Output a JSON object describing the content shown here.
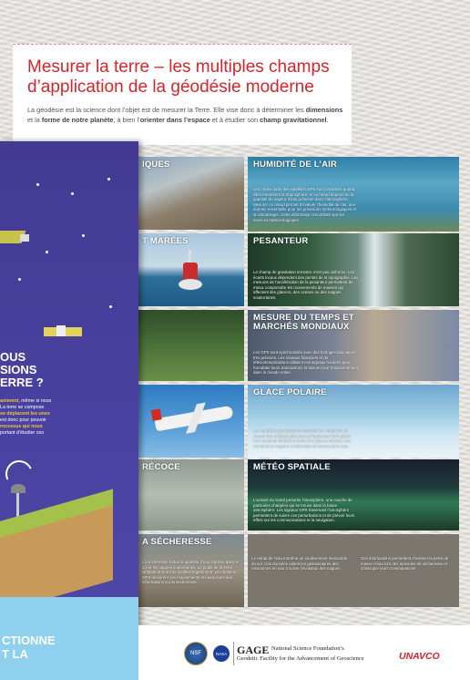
{
  "header": {
    "title": "Mesurer la terre – les multiples champs d’application de la géodésie moderne",
    "intro_parts": [
      "La géodésie est la science dont l’objet est de mesurer la Terre. Elle vise donc à déterminer les ",
      "dimensions",
      " et la ",
      "forme de notre planète",
      ", à bien l’",
      "orienter dans l’espace",
      " et à étudier son ",
      "champ gravitationnel",
      "."
    ]
  },
  "cards": {
    "left_labels": [
      "IQUES",
      "T MARÉES",
      "RÉCOCE",
      "A SÉCHERESSE"
    ],
    "humidity": {
      "title": "HUMIDITÉ DE L’AIR",
      "text": "Les ondes radio des satellites GPS sont retardées quand elles traversent la troposphère, et ce retard dépend de la quantité de vapeur d’eau présente dans l’atmosphère. Mesurer ce retard permet d’évaluer l’humidité de l’air, une donnée essentielle pour les prévisions météorologiques et la climatologie. Cette information est utilisée par les services météorologiques."
    },
    "gravity": {
      "title": "PESANTEUR",
      "text": "Le champ de gravitation terrestre n’est pas uniforme. Les écarts locaux dépendent des pentes de la topographie. Les mesures de l’accélération de la pesanteur permettent de mieux comprendre les mouvements de masses qui affectent des glaciers, des océans ou des nappes souterraines."
    },
    "time": {
      "title": "MESURE DU TEMPS ET MARCHÉS MONDIAUX",
      "text": "Les GPS sont synchronisés avec des horloges atomiques très précises. Les réseaux financiers et de télécommunications utilisent ces signaux horaires pour horodater leurs transactions et assurer leur fonctionnement dans le monde entier."
    },
    "ice": {
      "title": "GLACE POLAIRE",
      "text": "Les satellites géodésiques mesurent les variations de masse des calottes glaciaires et l’épaisseur de la glace. Ces mesures révèlent la fonte des glaces polaires, une contribution majeure à l’élévation du niveau de la mer."
    },
    "space": {
      "title": "MÉTÉO SPATIALE",
      "text": "L’activité du Soleil perturbe l’ionosphère, une couche de particules chargées qui se trouve dans la haute atmosphère. Les signaux GPS traversant l’ionosphère permettent de suivre ces perturbations et de prévoir leurs effets sur les communications et la navigation."
    },
    "bottom_texts": [
      "La sécheresse réduit la quantité d’eau stockée dans le sol et les nappes souterraines. Le poids de la Terre diminue et le sol se soulève légèrement. Les stations GPS mesurent ces mouvements et fournissent des informations sur la sécheresse.",
      "Le retrait de l’eau entraîne un soulèvement mesurable du sol. Ces données aident les gestionnaires des ressources en eau à suivre l’évolution des nappes.",
      "Ces informations permettent d’estimer la perte de masse d’eau lors des épisodes de sécheresse et d’anticiper leurs conséquences."
    ]
  },
  "poster": {
    "heading_lines": [
      "OUS",
      "SIONS",
      "ERRE ?"
    ],
    "body_html_parts": [
      "amment",
      ", même si nous",
      " La terre se compose",
      "se déplacent les unes",
      " est donc pour pouvoir",
      "rocessus qui nous",
      "portant d’étudier ces"
    ],
    "bottom_lines": [
      "CTIONNE",
      "T LA"
    ]
  },
  "footer": {
    "gage_name": "GAGE",
    "gage_line1": "National Science Foundation’s",
    "gage_line2": "Geodetic Facility for the Advancement of Geoscience",
    "unavco": "UNAVCO",
    "nsf_label": "NSF",
    "nasa_label": "NASA"
  },
  "colors": {
    "title_red": "#d8232a",
    "poster_purple": "#4a3f9a",
    "poster_yellow": "#f2c23a"
  }
}
